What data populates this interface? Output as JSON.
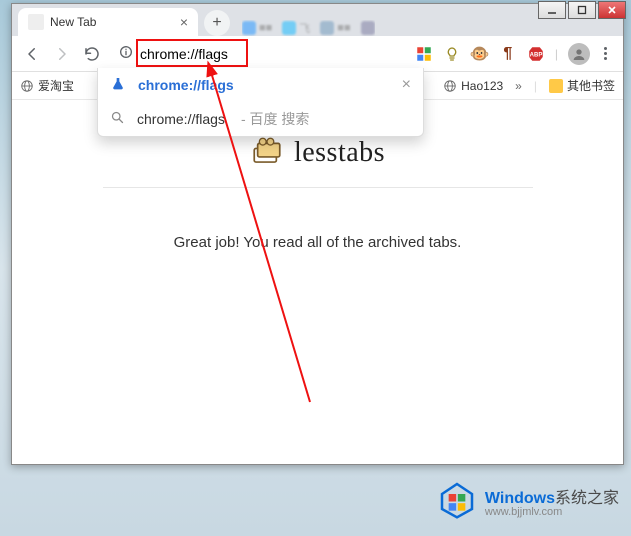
{
  "window_controls": {
    "minimize": "minimize",
    "maximize": "maximize",
    "close": "close"
  },
  "tab": {
    "title": "New Tab"
  },
  "omnibox": {
    "value": "chrome://flags"
  },
  "omnibox_suggestions": [
    {
      "icon": "flask",
      "label": "chrome://flags",
      "primary": true
    },
    {
      "icon": "search",
      "query": "chrome://flags",
      "hint": "- 百度 搜索"
    }
  ],
  "bookmarks": {
    "left": [
      {
        "label": "爱淘宝"
      }
    ],
    "right": [
      {
        "label": "Hao123"
      },
      {
        "label": "其他书签",
        "folder": true
      }
    ],
    "overflow": "»"
  },
  "page": {
    "brand": "lesstabs",
    "message": "Great job! You read all of the archived tabs."
  },
  "watermark": {
    "brand_left": "Windows",
    "brand_right": "系统之家",
    "url": "www.bjjmlv.com"
  }
}
